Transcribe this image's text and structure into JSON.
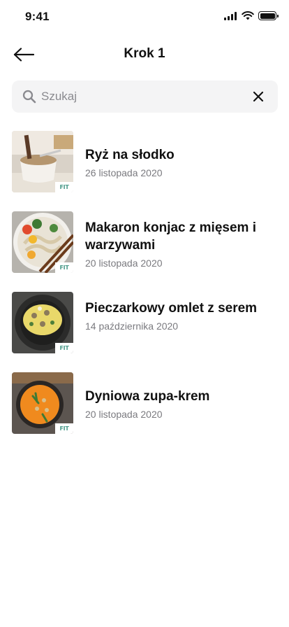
{
  "status_bar": {
    "time": "9:41"
  },
  "header": {
    "title": "Krok 1"
  },
  "search": {
    "placeholder": "Szukaj",
    "value": ""
  },
  "recipes": [
    {
      "title": "Ryż na słodko",
      "date": "26 listopada 2020",
      "badge": "FIT"
    },
    {
      "title": "Makaron konjac z mięsem i warzywami",
      "date": "20 listopada 2020",
      "badge": "FIT"
    },
    {
      "title": "Pieczarkowy omlet z serem",
      "date": "14 października 2020",
      "badge": "FIT"
    },
    {
      "title": "Dyniowa zupa-krem",
      "date": "20 listopada 2020",
      "badge": "FIT"
    }
  ],
  "colors": {
    "background": "#ffffff",
    "search_bg": "#f4f4f5",
    "text": "#111111",
    "muted": "#7a7a7f",
    "badge": "#4a9a8a"
  },
  "icons": [
    "arrow-left-icon",
    "search-icon",
    "close-icon",
    "signal-icon",
    "wifi-icon",
    "battery-icon"
  ]
}
